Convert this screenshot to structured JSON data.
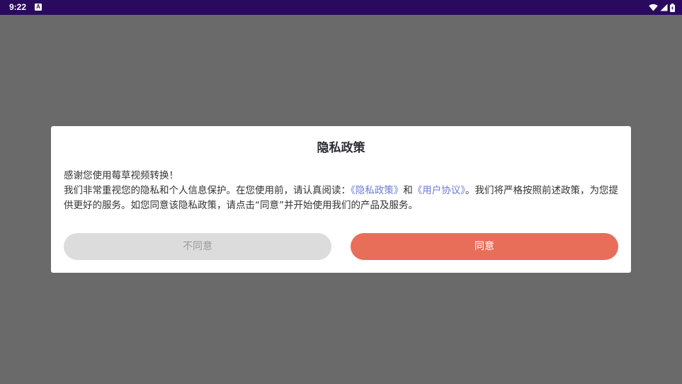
{
  "status_bar": {
    "time": "9:22",
    "notification_icon": "A",
    "icons": [
      "wifi-icon",
      "signal-icon",
      "battery-icon"
    ]
  },
  "dialog": {
    "title": "隐私政策",
    "line1": "感谢您使用莓草视频转换！",
    "para_prefix": "我们非常重视您的隐私和个人信息保护。在您使用前，请认真阅读：",
    "privacy_link": "《隐私政策》",
    "conjunction": "和",
    "agreement_link": "《用户协议》",
    "para_suffix": "。我们将严格按照前述政策，为您提供更好的服务。如您同意该隐私政策，请点击“同意”并开始使用我们的产品及服务。",
    "disagree_label": "不同意",
    "agree_label": "同意"
  },
  "colors": {
    "status_bar": "#2a0a5e",
    "overlay": "#6a6a6a",
    "link": "#6b79d9",
    "agree_button": "#e86e5a",
    "disagree_button": "#dcdcdc"
  }
}
